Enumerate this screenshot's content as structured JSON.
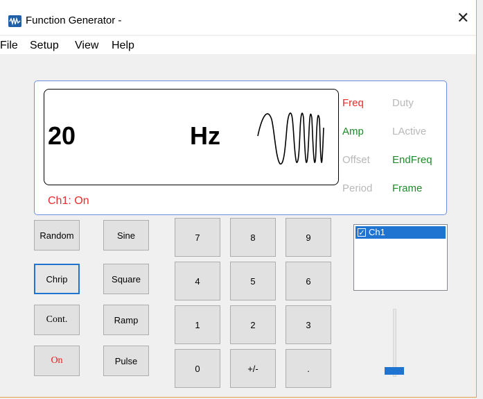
{
  "window": {
    "title": "Function Generator -"
  },
  "menu": [
    "File",
    "Setup",
    "View",
    "Help"
  ],
  "display": {
    "value": "20",
    "unit": "Hz",
    "status": "Ch1: On",
    "waveform_icon": "chirp-wave-icon"
  },
  "params": [
    {
      "label": "Freq",
      "state": "selected"
    },
    {
      "label": "Duty",
      "state": "disabled"
    },
    {
      "label": "Amp",
      "state": "enabled"
    },
    {
      "label": "LActive",
      "state": "disabled"
    },
    {
      "label": "Offset",
      "state": "disabled"
    },
    {
      "label": "EndFreq",
      "state": "enabled"
    },
    {
      "label": "Period",
      "state": "disabled"
    },
    {
      "label": "Frame",
      "state": "enabled"
    }
  ],
  "mode_buttons": [
    "Random",
    "Chrip",
    "Cont.",
    "On"
  ],
  "wave_buttons": [
    "Sine",
    "Square",
    "Ramp",
    "Pulse"
  ],
  "keypad": [
    "7",
    "8",
    "9",
    "4",
    "5",
    "6",
    "1",
    "2",
    "3",
    "0",
    "+/-",
    "."
  ],
  "channels": [
    {
      "label": "Ch1",
      "checked": true,
      "selected": true
    }
  ],
  "colors": {
    "selected": "#e82c2c",
    "enabled": "#1e8a2a",
    "disabled": "#b8b8b8",
    "accent": "#1f74d1"
  }
}
